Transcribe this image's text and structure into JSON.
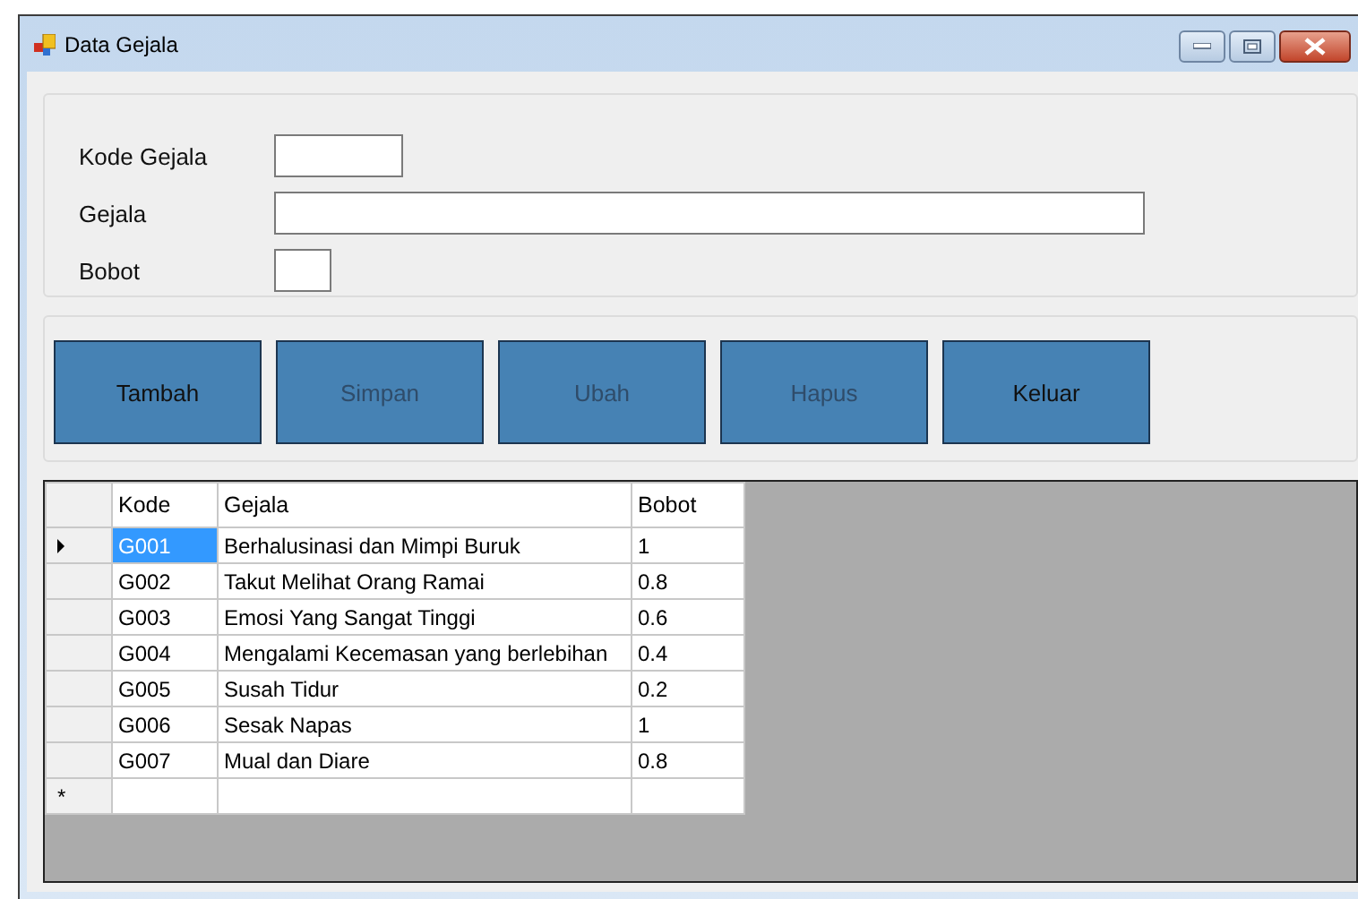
{
  "window": {
    "title": "Data Gejala"
  },
  "form": {
    "fields": [
      {
        "label": "Kode Gejala"
      },
      {
        "label": "Gejala"
      },
      {
        "label": "Bobot"
      }
    ]
  },
  "buttons": [
    {
      "label": "Tambah",
      "disabled": false
    },
    {
      "label": "Simpan",
      "disabled": true
    },
    {
      "label": "Ubah",
      "disabled": true
    },
    {
      "label": "Hapus",
      "disabled": true
    },
    {
      "label": "Keluar",
      "disabled": false
    }
  ],
  "table": {
    "columns": [
      "Kode",
      "Gejala",
      "Bobot"
    ],
    "rows": [
      {
        "cells": [
          "G001",
          "Berhalusinasi dan Mimpi Buruk",
          "1"
        ],
        "selected": true
      },
      {
        "cells": [
          "G002",
          "Takut Melihat Orang Ramai",
          "0.8"
        ],
        "selected": false
      },
      {
        "cells": [
          "G003",
          "Emosi Yang Sangat Tinggi",
          "0.6"
        ],
        "selected": false
      },
      {
        "cells": [
          "G004",
          "Mengalami Kecemasan yang berlebihan",
          "0.4"
        ],
        "selected": false
      },
      {
        "cells": [
          "G005",
          "Susah Tidur",
          "0.2"
        ],
        "selected": false
      },
      {
        "cells": [
          "G006",
          "Sesak Napas",
          "1"
        ],
        "selected": false
      },
      {
        "cells": [
          "G007",
          "Mual dan Diare",
          "0.8"
        ],
        "selected": false
      }
    ],
    "new_row_marker": "*"
  }
}
